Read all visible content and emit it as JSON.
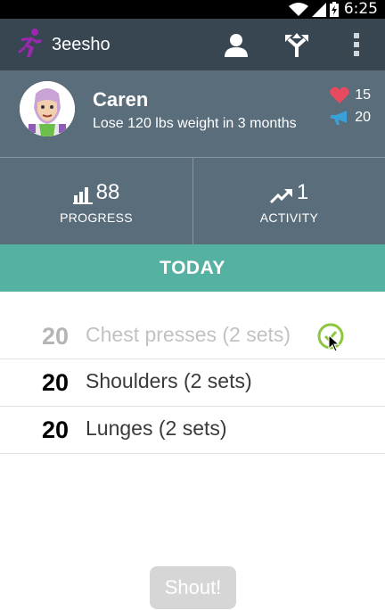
{
  "status_bar": {
    "time": "6:25"
  },
  "action_bar": {
    "title": "3eesho",
    "icons": [
      "runner-logo-icon",
      "person-icon",
      "directions-icon",
      "overflow-menu-icon"
    ]
  },
  "profile": {
    "name": "Caren",
    "goal": "Lose 120 lbs weight in 3 months",
    "likes": "15",
    "shouts": "20",
    "colors": {
      "heart": "#e84a5f",
      "megaphone": "#3aa0d8"
    }
  },
  "stats": {
    "progress": {
      "value": "88",
      "label": "PROGRESS"
    },
    "activity": {
      "value": "1",
      "label": "ACTIVITY"
    }
  },
  "today": {
    "label": "TODAY"
  },
  "exercises": [
    {
      "reps": "20",
      "name": "Chest presses (2 sets)",
      "done": true
    },
    {
      "reps": "20",
      "name": "Shoulders (2 sets)",
      "done": false
    },
    {
      "reps": "20",
      "name": "Lunges (2 sets)",
      "done": false
    }
  ],
  "shout_button": {
    "label": "Shout!"
  },
  "colors": {
    "action_bar": "#374650",
    "profile_bg": "#5a6d7b",
    "today_bar": "#55b1a1",
    "check": "#8dc63f"
  }
}
